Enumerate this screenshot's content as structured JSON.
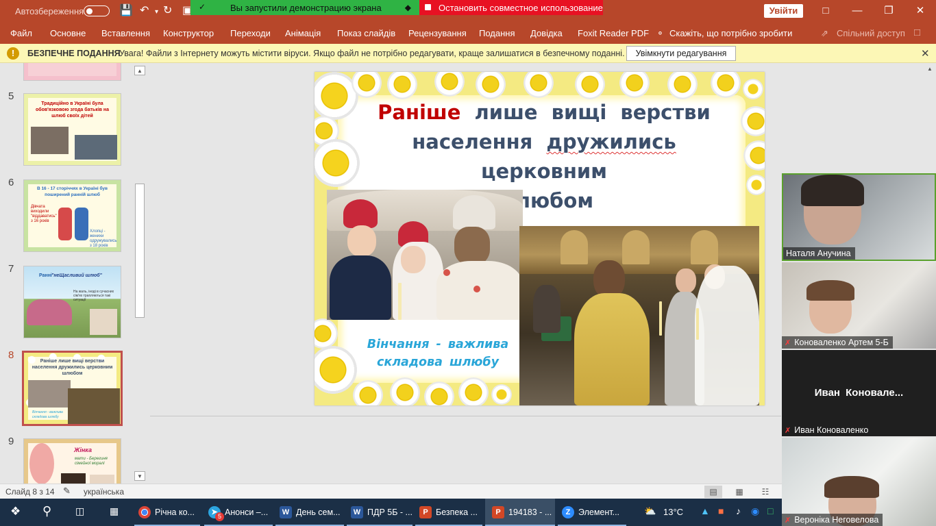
{
  "titlebar": {
    "autosave_label": "Автозбереження",
    "share_running": "Вы запустили демонстрацию экрана",
    "share_stop": "Остановить совместное использование",
    "login_label": "Увійти"
  },
  "ribbon": {
    "tabs": [
      "Файл",
      "Основне",
      "Вставлення",
      "Конструктор",
      "Переходи",
      "Анімація",
      "Показ слайдів",
      "Рецензування",
      "Подання",
      "Довідка",
      "Foxit Reader PDF"
    ],
    "tell_me": "Скажіть, що потрібно зробити",
    "share": "Спільний доступ"
  },
  "protected_view": {
    "title": "БЕЗПЕЧНЕ ПОДАННЯ",
    "message": "Увага! Файли з Інтернету можуть містити віруси. Якщо файл не потрібно редагувати, краще залишатися в безпечному поданні.",
    "enable_button": "Увімкнути редагування"
  },
  "thumbnails": [
    {
      "number": "5",
      "text": "Традиційно в Україні була обов'язковою згода батьків на шлюб своїх дітей"
    },
    {
      "number": "6",
      "text": "В 16 - 17 сторіччях в Україні був поширений ранній шлюб",
      "sub1": "Дівчата виходили \"віддаватись\" з 16 років",
      "sub2": "Хлопці - женихи одружувались з 18 років"
    },
    {
      "number": "7",
      "text": "\"неЩасливий шлюб\"",
      "sub1": "Ранні",
      "sub2": "На жаль, іноді в сучасних сім'ях трапляються такі ситуації"
    },
    {
      "number": "8",
      "text": "Раніше лише вищі верстви населення дружились церковним шлюбом",
      "sub1": "Вінчання - важлива складова шлюбу"
    },
    {
      "number": "9",
      "text": "Жінка",
      "sub1": "мати - Берегиня сімейної моралі"
    }
  ],
  "slide": {
    "title_red": "Раніше",
    "title_rest1": "лише вищі верстви",
    "title_line2a": "населення",
    "title_line2b": "дружились",
    "title_line2c": "церковним",
    "title_line3": "шлюбом",
    "caption": "Вінчання - важлива складова шлюбу"
  },
  "participants": [
    {
      "name": "Наталя Анучина",
      "muted": false
    },
    {
      "name": "Коноваленко Артем 5-Б",
      "muted": true
    },
    {
      "name": "Иван Коноваленко",
      "muted": true,
      "big_label": "Иван Коновале..."
    },
    {
      "name": "Вероніка Неговелова",
      "muted": true
    }
  ],
  "statusbar": {
    "slide_info": "Слайд 8 з 14",
    "language": "українська"
  },
  "taskbar": {
    "items": [
      {
        "label": "Річна ко...",
        "icon": "chrome-icon"
      },
      {
        "label": "Анонси –...",
        "icon": "telegram-icon",
        "badge": "5"
      },
      {
        "label": "День сем...",
        "icon": "word-icon"
      },
      {
        "label": "ПДР 5Б - ...",
        "icon": "word-icon"
      },
      {
        "label": "Безпека ...",
        "icon": "powerpoint-icon"
      },
      {
        "label": "194183 - ...",
        "icon": "powerpoint-icon"
      },
      {
        "label": "Элемент...",
        "icon": "zoom-icon"
      }
    ],
    "temperature": "13°C"
  },
  "colors": {
    "accent": "#b7472a",
    "share_green": "#2fb344",
    "share_red": "#e81123",
    "title_red": "#c00000",
    "title_blue": "#3c4f6b",
    "caption_blue": "#2aa6d8"
  }
}
